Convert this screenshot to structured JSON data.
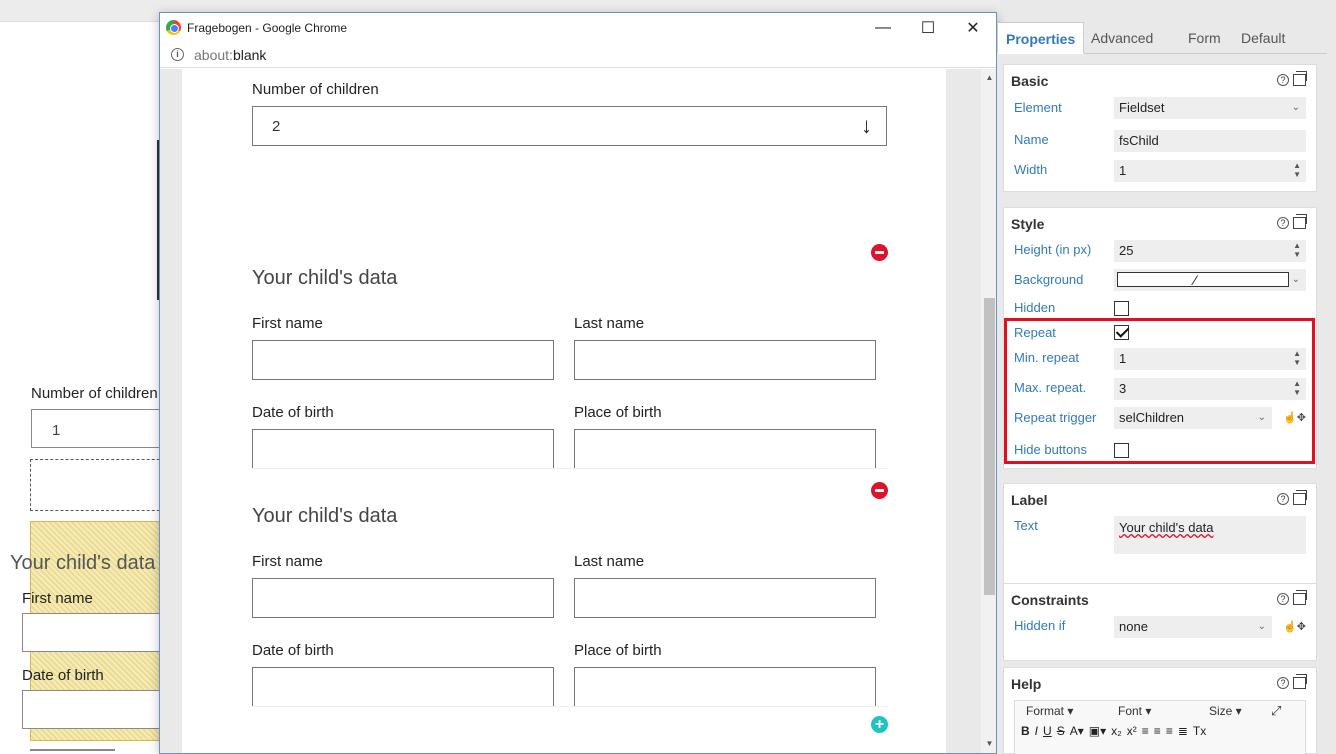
{
  "background_form": {
    "number_children_label": "Number of children",
    "number_children_value": "1",
    "fieldset_title": "Your child's data",
    "first_name_label": "First name",
    "dob_label": "Date of birth"
  },
  "chrome": {
    "title": "Fragebogen - Google Chrome",
    "url_scheme": "about:",
    "url_host": "blank",
    "minimize_glyph": "—",
    "maximize_glyph": "☐",
    "close_glyph": "✕"
  },
  "form": {
    "number_children_label": "Number of children",
    "number_children_value": "2",
    "dropdown_arrow": "↓",
    "fieldsets": [
      {
        "title": "Your child's data",
        "first_name_label": "First name",
        "last_name_label": "Last name",
        "dob_label": "Date of birth",
        "pob_label": "Place of birth"
      },
      {
        "title": "Your child's data",
        "first_name_label": "First name",
        "last_name_label": "Last name",
        "dob_label": "Date of birth",
        "pob_label": "Place of birth"
      }
    ]
  },
  "panel": {
    "tabs": [
      "Properties",
      "Advanced",
      "Form",
      "Default"
    ],
    "basic": {
      "title": "Basic",
      "element_label": "Element",
      "element_value": "Fieldset",
      "name_label": "Name",
      "name_value": "fsChild",
      "width_label": "Width",
      "width_value": "1"
    },
    "style": {
      "title": "Style",
      "height_label": "Height (in px)",
      "height_value": "25",
      "background_label": "Background",
      "hidden_label": "Hidden",
      "hidden_checked": false,
      "repeat_label": "Repeat",
      "repeat_checked": true,
      "min_repeat_label": "Min. repeat",
      "min_repeat_value": "1",
      "max_repeat_label": "Max. repeat.",
      "max_repeat_value": "3",
      "repeat_trigger_label": "Repeat trigger",
      "repeat_trigger_value": "selChildren",
      "hide_buttons_label": "Hide buttons",
      "hide_buttons_checked": false,
      "highlight_color": "#e01020"
    },
    "label": {
      "title": "Label",
      "text_label": "Text",
      "text_value": "Your child's data"
    },
    "constraints": {
      "title": "Constraints",
      "hidden_if_label": "Hidden if",
      "hidden_if_value": "none"
    },
    "help": {
      "title": "Help",
      "format_label": "Format",
      "font_label": "Font",
      "size_label": "Size"
    }
  },
  "colors": {
    "accent_blue": "#337ab7",
    "remove_red": "#e0112b",
    "add_teal": "#1dc4c4"
  }
}
